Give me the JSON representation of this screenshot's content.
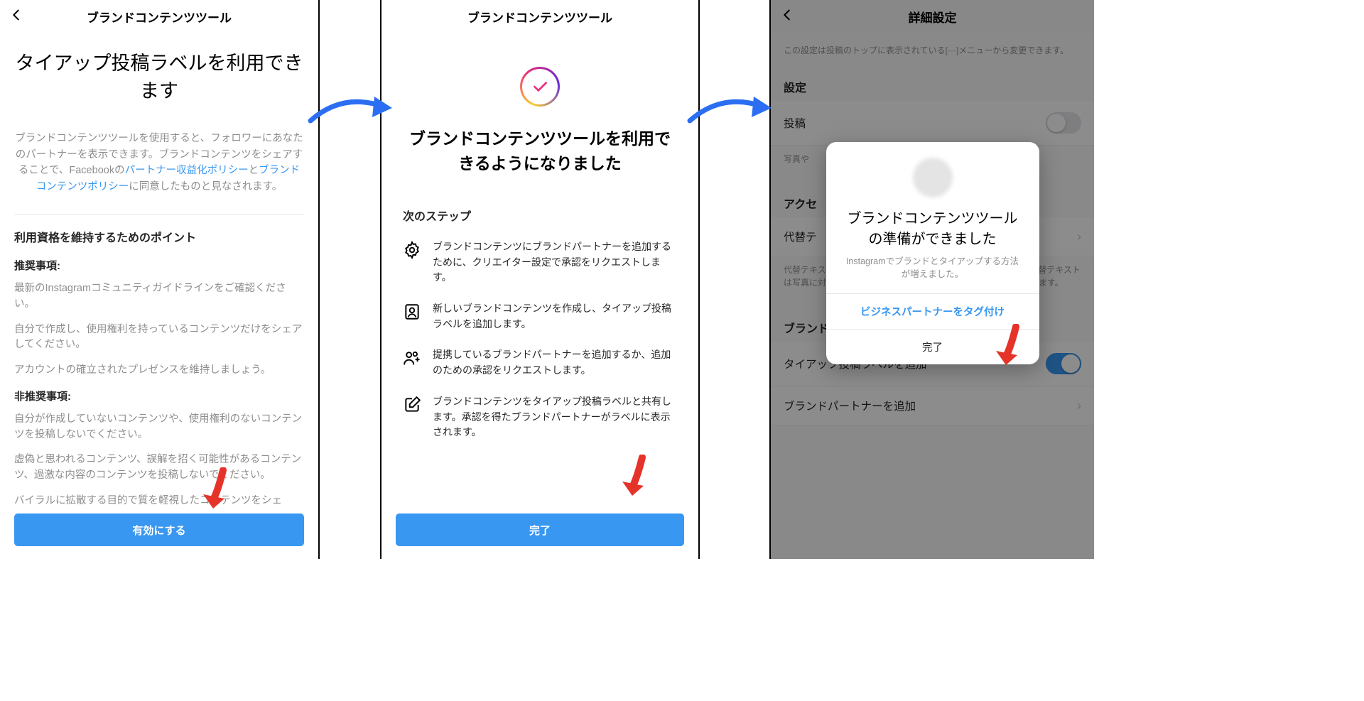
{
  "screen1": {
    "header_title": "ブランドコンテンツツール",
    "title": "タイアップ投稿ラベルを利用できます",
    "desc_1": "ブランドコンテンツツールを使用すると、フォロワーにあなたのパートナーを表示できます。ブランドコンテンツをシェアすることで、Facebookの",
    "link_1": "パートナー収益化ポリシー",
    "desc_2": "と",
    "link_2": "ブランドコンテンツポリシー",
    "desc_3": "に同意したものと見なされます。",
    "section_h": "利用資格を維持するためのポイント",
    "rec_h": "推奨事項:",
    "rec_1": "最新のInstagramコミュニティガイドラインをご確認ください。",
    "rec_2": "自分で作成し、使用権利を持っているコンテンツだけをシェアしてください。",
    "rec_3": "アカウントの確立されたプレゼンスを維持しましょう。",
    "no_rec_h": "非推奨事項:",
    "no_rec_1": "自分が作成していないコンテンツや、使用権利のないコンテンツを投稿しないでください。",
    "no_rec_2": "虚偽と思われるコンテンツ、誤解を招く可能性があるコンテンツ、過激な内容のコンテンツを投稿しないでください。",
    "no_rec_3": "バイラルに拡散する目的で質を軽視したコンテンツをシェ",
    "button": "有効にする"
  },
  "screen2": {
    "header_title": "ブランドコンテンツツール",
    "title": "ブランドコンテンツツールを利用できるようになりました",
    "next_h": "次のステップ",
    "step_1": "ブランドコンテンツにブランドパートナーを追加するために、クリエイター設定で承認をリクエストします。",
    "step_2": "新しいブランドコンテンツを作成し、タイアップ投稿ラベルを追加します。",
    "step_3": "提携しているブランドパートナーを追加するか、追加のための承認をリクエストします。",
    "step_4": "ブランドコンテンツをタイアップ投稿ラベルと共有します。承認を得たブランドパートナーがラベルに表示されます。",
    "button": "完了"
  },
  "screen3": {
    "header_title": "詳細設定",
    "note": "この設定は投稿のトップに表示されている[···]メニューから変更できます。",
    "settings_h": "設定",
    "row_post": "投稿",
    "row_photo": "写真や",
    "acc_h": "アクセ",
    "row_alt": "代替テ",
    "alt_note": "代替テキストは、視覚障がいのあるユーザーのためのものです。代替テキストは写真に対して自動で作成されますが、自分で作成することもできます。",
    "brand_h": "ブランド",
    "row_tie": "タイアップ投稿ラベルを追加",
    "row_partner": "ブランドパートナーを追加",
    "modal": {
      "title": "ブランドコンテンツツールの準備ができました",
      "sub": "Instagramでブランドとタイアップする方法が増えました。",
      "btn_tag": "ビジネスパートナーをタグ付け",
      "btn_done": "完了"
    }
  }
}
